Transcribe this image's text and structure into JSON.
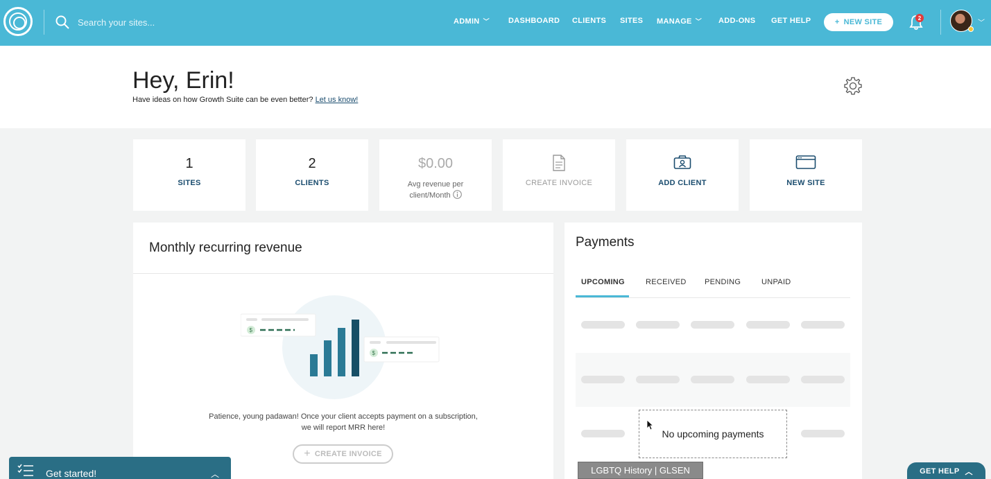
{
  "nav": {
    "search_placeholder": "Search your sites...",
    "items": [
      {
        "label": "ADMIN",
        "dropdown": true
      },
      {
        "label": "DASHBOARD",
        "dropdown": false
      },
      {
        "label": "CLIENTS",
        "dropdown": false
      },
      {
        "label": "SITES",
        "dropdown": false
      },
      {
        "label": "MANAGE",
        "dropdown": true
      },
      {
        "label": "ADD-ONS",
        "dropdown": false
      },
      {
        "label": "GET HELP",
        "dropdown": false
      }
    ],
    "new_site_label": "NEW SITE",
    "notification_count": "2",
    "chevron": "﹀"
  },
  "header": {
    "greeting": "Hey, Erin!",
    "subline": "Have ideas on how Growth Suite can be even better?",
    "subline_link": "Let us know!"
  },
  "cards": {
    "sites": {
      "value": "1",
      "label": "SITES"
    },
    "clients": {
      "value": "2",
      "label": "CLIENTS"
    },
    "avg_revenue": {
      "value": "$0.00",
      "label_line1": "Avg revenue per",
      "label_line2": "client/Month"
    },
    "create_invoice": {
      "label": "CREATE INVOICE"
    },
    "add_client": {
      "label": "ADD CLIENT"
    },
    "new_site": {
      "label": "NEW SITE"
    }
  },
  "mrr": {
    "title": "Monthly recurring revenue",
    "message_line1": "Patience, young padawan! Once your client accepts payment on a subscription,",
    "message_line2": "we will report MRR here!",
    "button_label": "CREATE INVOICE"
  },
  "payments": {
    "title": "Payments",
    "tabs": [
      "UPCOMING",
      "RECEIVED",
      "PENDING",
      "UNPAID"
    ],
    "active_tab": "UPCOMING",
    "empty_message": "No upcoming payments"
  },
  "tooltip": "LGBTQ History | GLSEN",
  "get_started": {
    "label": "Get started!",
    "chevron": "︿"
  },
  "get_help": {
    "label": "GET HELP",
    "chevron": "︿"
  },
  "colors": {
    "brand": "#4ab8d6",
    "dark_teal": "#2a6e85",
    "link": "#1a4c6e"
  }
}
